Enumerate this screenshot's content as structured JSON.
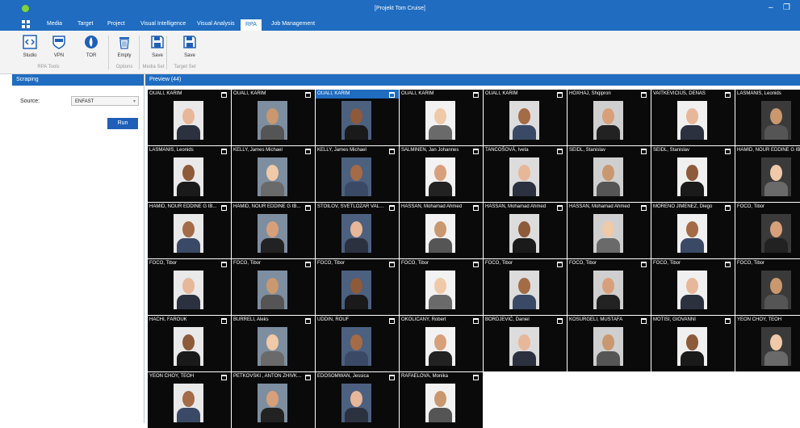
{
  "window": {
    "title": "[Projekt Tom Cruise]"
  },
  "menu": [
    "Media",
    "Target",
    "Project",
    "Visual Intelligence",
    "Visual Analysis",
    "RPA",
    "Job Management"
  ],
  "menu_active": "RPA",
  "ribbon": {
    "buttons": [
      {
        "label": "Studio",
        "icon": "code-icon"
      },
      {
        "label": "VPN",
        "icon": "vpn-icon"
      },
      {
        "label": "TOR",
        "icon": "tor-icon"
      },
      {
        "label": "Empty",
        "icon": "trash-icon"
      },
      {
        "label": "Save",
        "icon": "save-icon"
      },
      {
        "label": "Save",
        "icon": "save-icon"
      }
    ],
    "groups": [
      "RPA Tools",
      "Options",
      "Media Set",
      "Target Set"
    ]
  },
  "scraping": {
    "title": "Scraping",
    "source_label": "Source:",
    "source_value": "ENFAST",
    "run_label": "Run"
  },
  "preview": {
    "title": "Preview (44)",
    "tiles": [
      "OUALI, KARIM",
      "OUALI, KARIM",
      "OUALI, KARIM",
      "OUALI, KARIM",
      "OUALI, KARIM",
      "HOXHAJ, Shqipron",
      "VAITKEVICIUS, DENAS",
      "LASMANIS, Leonids",
      "LASMANIS, Leonids",
      "KELLY, James Michael",
      "KELLY, James Michael",
      "SALMINEN, Jan Johannes",
      "TANCOŠOVÁ, Iveta",
      "SEIDL, Stanislav",
      "SEIDL, Stanislav",
      "HAMID, NOUR EDDINE G IB...",
      "HAMID, NOUR EDDINE G IB...",
      "HAMID, NOUR EDDINE G IB...",
      "STOILOV, SVETLOZAR VALEN...",
      "HASSAN, Mohamad Ahmed",
      "HASSAN, Mohamad Ahmed",
      "HASSAN, Mohamad Ahmed",
      "MORENO JIMENEZ, Diego",
      "FOCO, Tibor",
      "FOCO, Tibor",
      "FOCO, Tibor",
      "FOCO, Tibor",
      "FOCO, Tibor",
      "FOCO, Tibor",
      "FOCO, Tibor",
      "FOCO, Tibor",
      "FOCO, Tibor",
      "HACHI, FAROUK",
      "BURRELI, Aleks",
      "UDDIN, ROUF",
      "OKOLICANY, Robert",
      "BORDJEVIĆ, Daniel",
      "KOSURGELI, MUSTAFA",
      "MOTISI, GIOVANNI",
      "YEON CHOY, TEOH",
      "YEON CHOY, TEOH",
      "PETKOVSKI , ANTON ZHIVKOV",
      "EDOSOMWAN, Jessica",
      "RAFAELOVA, Monika"
    ]
  },
  "colors": {
    "accent": "#1f6cc0",
    "tile_bg": "#0a0a0a"
  }
}
